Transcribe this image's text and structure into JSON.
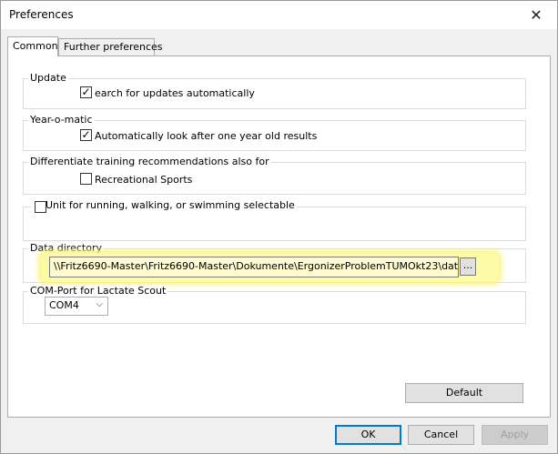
{
  "window": {
    "title": "Preferences",
    "close_glyph": "✕"
  },
  "tabs": [
    {
      "label": "Common",
      "active": true
    },
    {
      "label": "Further preferences",
      "active": false
    }
  ],
  "groups": {
    "update": {
      "title": "Update",
      "checkbox_label": "earch for updates automatically",
      "checked": true
    },
    "yearomatic": {
      "title": "Year-o-matic",
      "checkbox_label": "Automatically look after one year old results",
      "checked": true
    },
    "differentiate": {
      "title": "Differentiate training recommendations also for",
      "checkbox_label": "Recreational Sports",
      "checked": false
    },
    "unit": {
      "checkbox_label": "Unit for running, walking, or swimming selectable",
      "checked": false
    },
    "data_directory": {
      "title": "Data directory",
      "value": "\\\\Fritz6690-Master\\Fritz6690-Master\\Dokumente\\ErgonizerProblemTUMOkt23\\dat",
      "browse_label": "...",
      "highlight_color": "#fbf47f"
    },
    "com_port": {
      "title": "COM-Port for Lactate Scout",
      "selected": "COM4"
    }
  },
  "buttons": {
    "default": "Default",
    "ok": "OK",
    "cancel": "Cancel",
    "apply": "Apply"
  },
  "check_glyph": "✓",
  "chevron_glyph": "⌵"
}
